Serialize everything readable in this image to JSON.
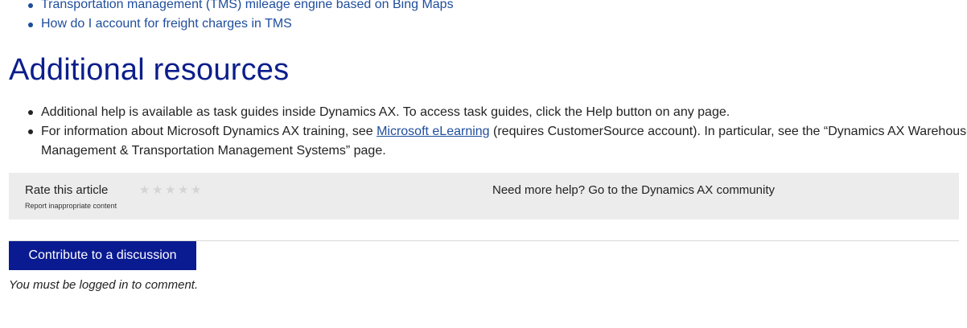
{
  "related_links": [
    {
      "label": "Transportation management (TMS) mileage engine based on Bing Maps"
    },
    {
      "label": "How do I account for freight charges in TMS"
    }
  ],
  "additional_resources": {
    "title": "Additional resources",
    "items": [
      {
        "text": "Additional help is available as task guides inside Dynamics AX. To access task guides, click the Help button on any page."
      },
      {
        "text_before": "For information about Microsoft Dynamics AX training, see ",
        "link_label": "Microsoft eLearning",
        "text_after": " (requires CustomerSource account). In particular, see the “Dynamics AX Warehouse Management & Transportation Management Systems” page."
      }
    ]
  },
  "rating": {
    "label": "Rate this article",
    "stars": [
      "★",
      "★",
      "★",
      "★",
      "★"
    ],
    "star_color": "#d4d4d4",
    "report_label": "Report inappropriate content",
    "community_text": "Need more help? Go to the Dynamics AX community"
  },
  "discussion": {
    "button_label": "Contribute to a discussion",
    "login_note": "You must be logged in to comment."
  },
  "colors": {
    "link": "#1e4d9b",
    "title": "#0c1e8c",
    "button_bg": "#0a1a91",
    "rate_bar_bg": "#ececec"
  }
}
